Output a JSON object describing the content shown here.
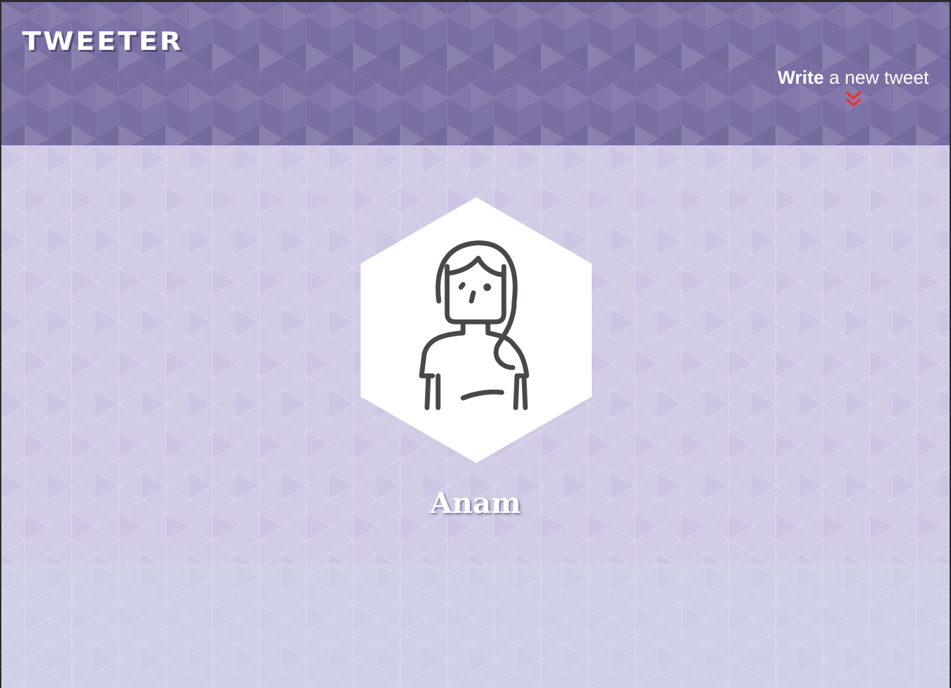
{
  "app": {
    "brand": "TWEETER"
  },
  "nav": {
    "compose_bold": "Write",
    "compose_rest": " a new tweet",
    "compose_icon": "double-chevron-down-icon",
    "compose_icon_color": "#e8332c"
  },
  "profile": {
    "name": "Anam",
    "avatar_icon": "woman-avatar-icon"
  },
  "colors": {
    "header": "#7a6ea3",
    "profile_bg": "#d2cbe6",
    "lower_bg": "#cfd2e7",
    "avatar_bg": "#ffffff",
    "avatar_stroke": "#4a4846"
  }
}
